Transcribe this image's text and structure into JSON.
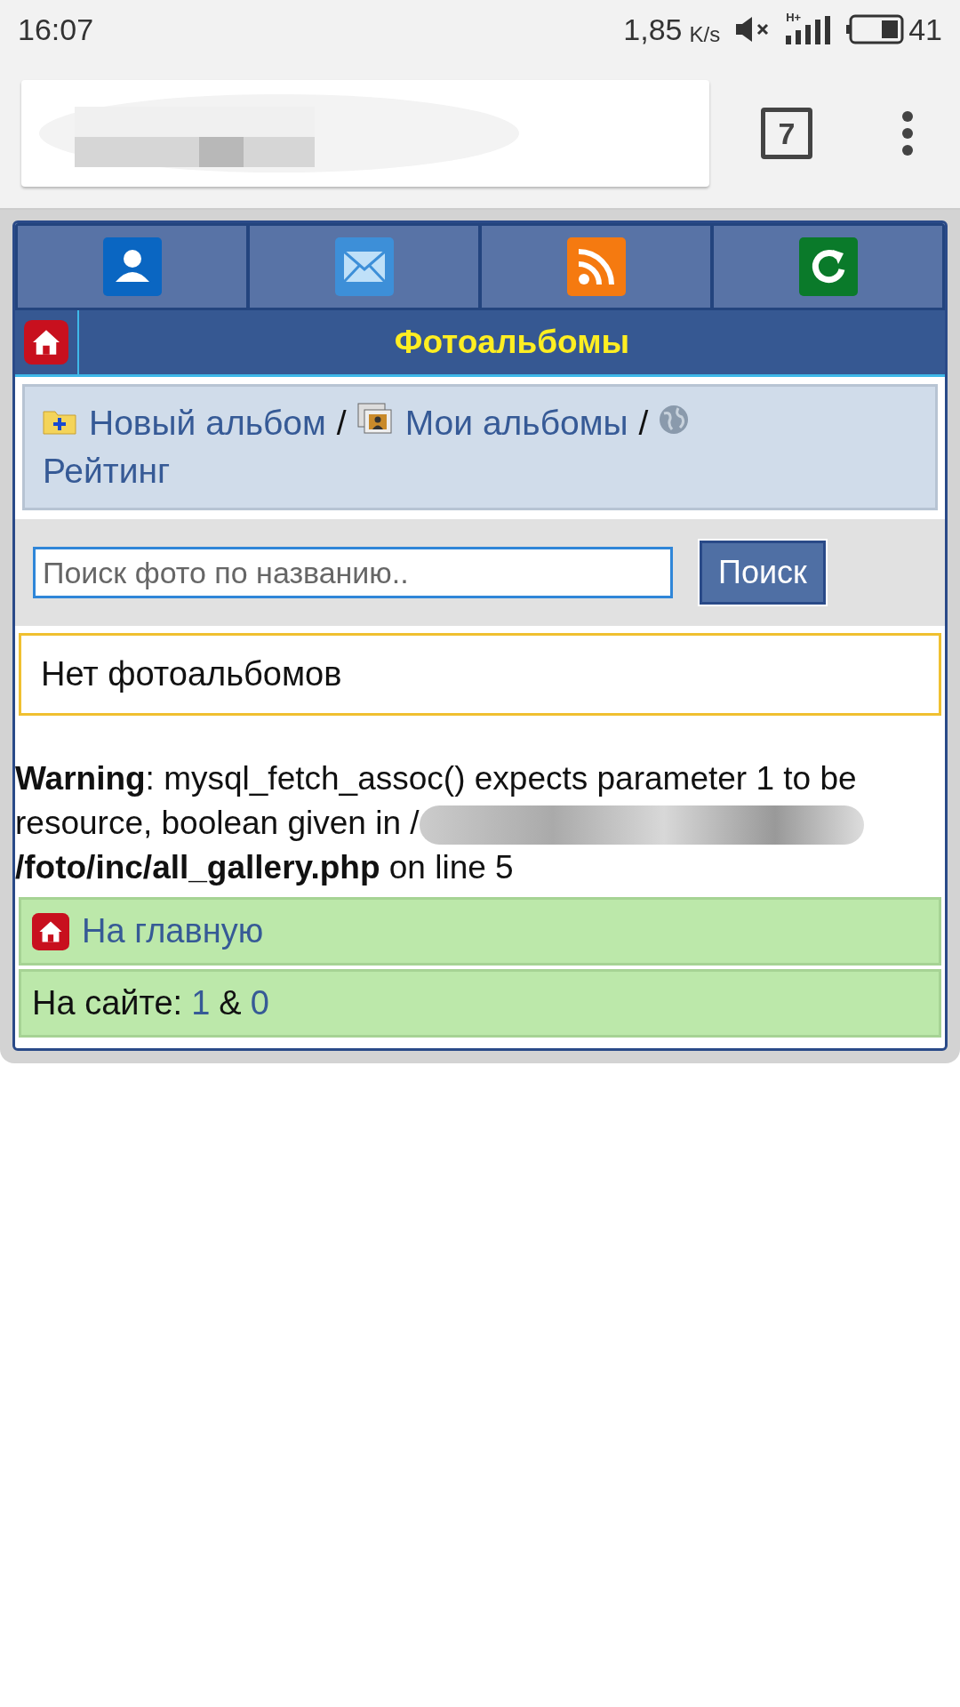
{
  "status_bar": {
    "time": "16:07",
    "speed": "1,85",
    "speed_unit": "K/s",
    "network": "H+",
    "battery": "41"
  },
  "browser": {
    "tab_count": "7"
  },
  "nav_icons": [
    {
      "kind": "profile"
    },
    {
      "kind": "mail"
    },
    {
      "kind": "rss"
    },
    {
      "kind": "refresh"
    }
  ],
  "title": "Фотоальбомы",
  "links": [
    {
      "kind": "new",
      "label": "Новый альбом",
      "separator": "/"
    },
    {
      "kind": "mine",
      "label": "Мои альбомы",
      "separator": "/"
    },
    {
      "kind": "rating",
      "label": "Рейтинг"
    }
  ],
  "search": {
    "placeholder": "Поиск фото по названию..",
    "button": "Поиск"
  },
  "notice": "Нет фотоальбомов",
  "warning": {
    "label": "Warning",
    "message": ": mysql_fetch_assoc() expects parameter 1 to be resource, boolean given in",
    "path_start": "/",
    "path_end": "/foto/inc/all_gallery.php",
    "line": "on line 5"
  },
  "home_link": "На главную",
  "online": {
    "label": "На сайте:",
    "members": "1",
    "separator": "&",
    "guests": "0"
  }
}
